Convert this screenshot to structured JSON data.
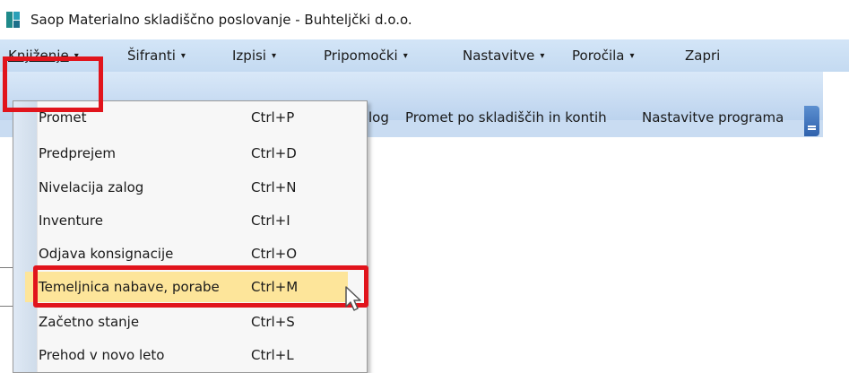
{
  "window": {
    "title": "Saop  Materialno skladiščno poslovanje - Buhteljčki d.o.o."
  },
  "menubar": [
    {
      "label": "Knjiženje",
      "arrow": "▾"
    },
    {
      "label": "Šifranti",
      "arrow": "▾"
    },
    {
      "label": "Izpisi",
      "arrow": "▾"
    },
    {
      "label": "Pripomočki",
      "arrow": "▾"
    },
    {
      "label": "Nastavitve",
      "arrow": "▾"
    },
    {
      "label": "Poročila",
      "arrow": "▾"
    },
    {
      "label": "Zapri",
      "arrow": ""
    }
  ],
  "toolbar": {
    "items": [
      "log",
      "Promet po skladiščih in kontih",
      "Nastavitve programa"
    ]
  },
  "dropdown": {
    "items": [
      {
        "label": "Promet",
        "shortcut": "Ctrl+P"
      },
      {
        "label": "Predprejem",
        "shortcut": "Ctrl+D"
      },
      {
        "label": "Nivelacija zalog",
        "shortcut": "Ctrl+N"
      },
      {
        "label": "Inventure",
        "shortcut": "Ctrl+I"
      },
      {
        "label": "Odjava konsignacije",
        "shortcut": "Ctrl+O"
      },
      {
        "label": "Temeljnica nabave, porabe",
        "shortcut": "Ctrl+M"
      },
      {
        "label": "Začetno stanje",
        "shortcut": "Ctrl+S"
      },
      {
        "label": "Prehod v novo leto",
        "shortcut": "Ctrl+L"
      }
    ]
  },
  "colors": {
    "highlight_border": "#e1141c",
    "selected_item_bg": "#fde59a",
    "menubar_bg": "#c4daf1"
  },
  "icons": {
    "app": "saop-app-icon",
    "toolbar_overflow": "chevron-down-icon",
    "cursor": "mouse-pointer-icon"
  }
}
